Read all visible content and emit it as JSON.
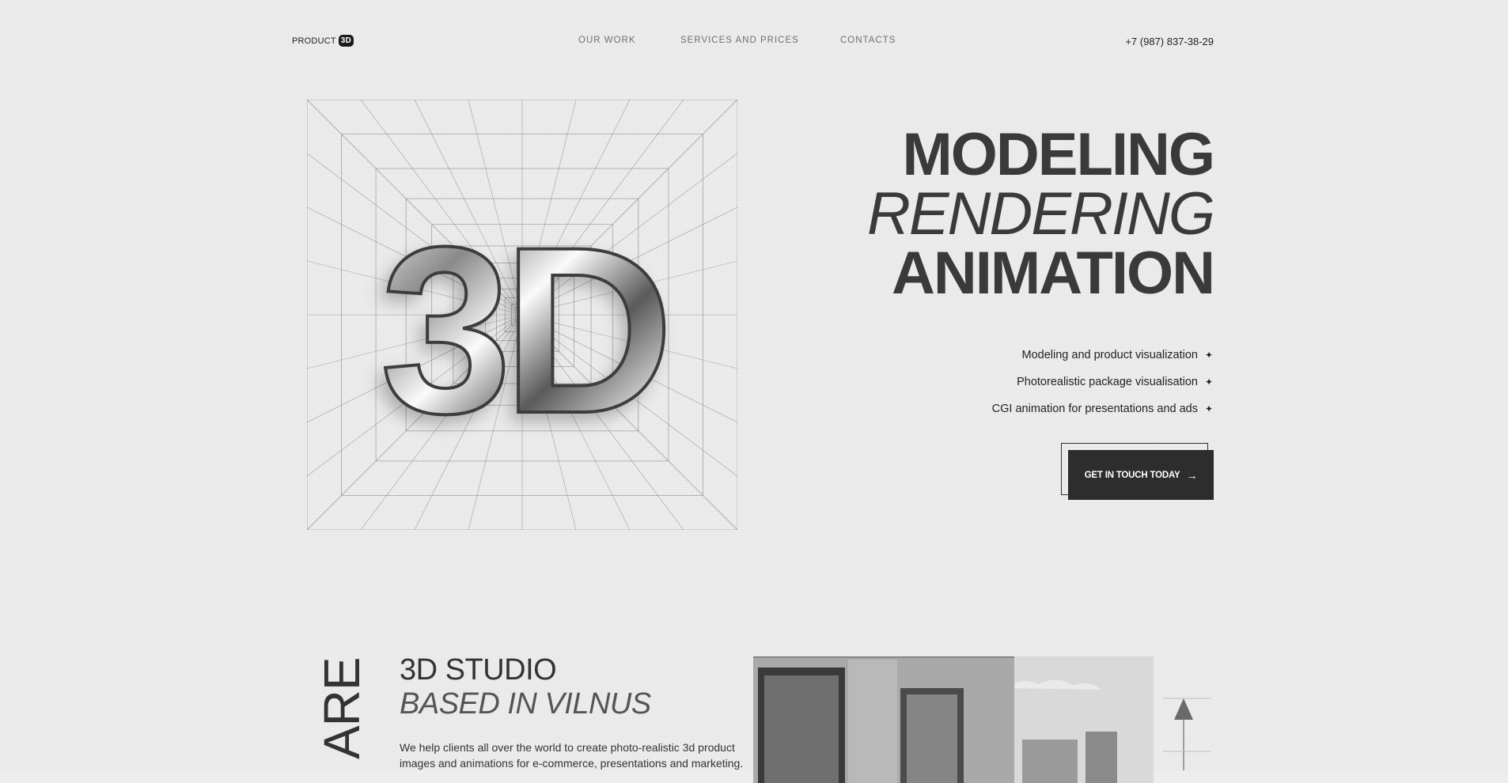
{
  "header": {
    "logo_text": "PRODUCT",
    "logo_badge": "3D",
    "nav": [
      {
        "label": "OUR WORK"
      },
      {
        "label": "SERVICES AND PRICES"
      },
      {
        "label": "CONTACTS"
      }
    ],
    "phone": "+7 (987) 837-38-29"
  },
  "hero": {
    "art_text": "3D",
    "headline": [
      "MODELING",
      "RENDERING",
      "ANIMATION"
    ],
    "features": [
      "Modeling and product visualization",
      "Photorealistic package visualisation",
      "CGI animation for presentations and ads"
    ],
    "feature_icon": "sparkle-star-icon",
    "cta_label": "GET IN TOUCH TODAY",
    "cta_icon": "arrow-right-icon"
  },
  "about": {
    "vertical_word": "ARE",
    "title": "3D STUDIO",
    "subtitle": "BASED IN VILNUS",
    "description": "We help clients all over the world to create photo-realistic 3d product images and animations for e-commerce, presentations and marketing."
  },
  "colors": {
    "background": "#ededed",
    "text": "#2b2b2b",
    "button": "#2d2d2d"
  }
}
